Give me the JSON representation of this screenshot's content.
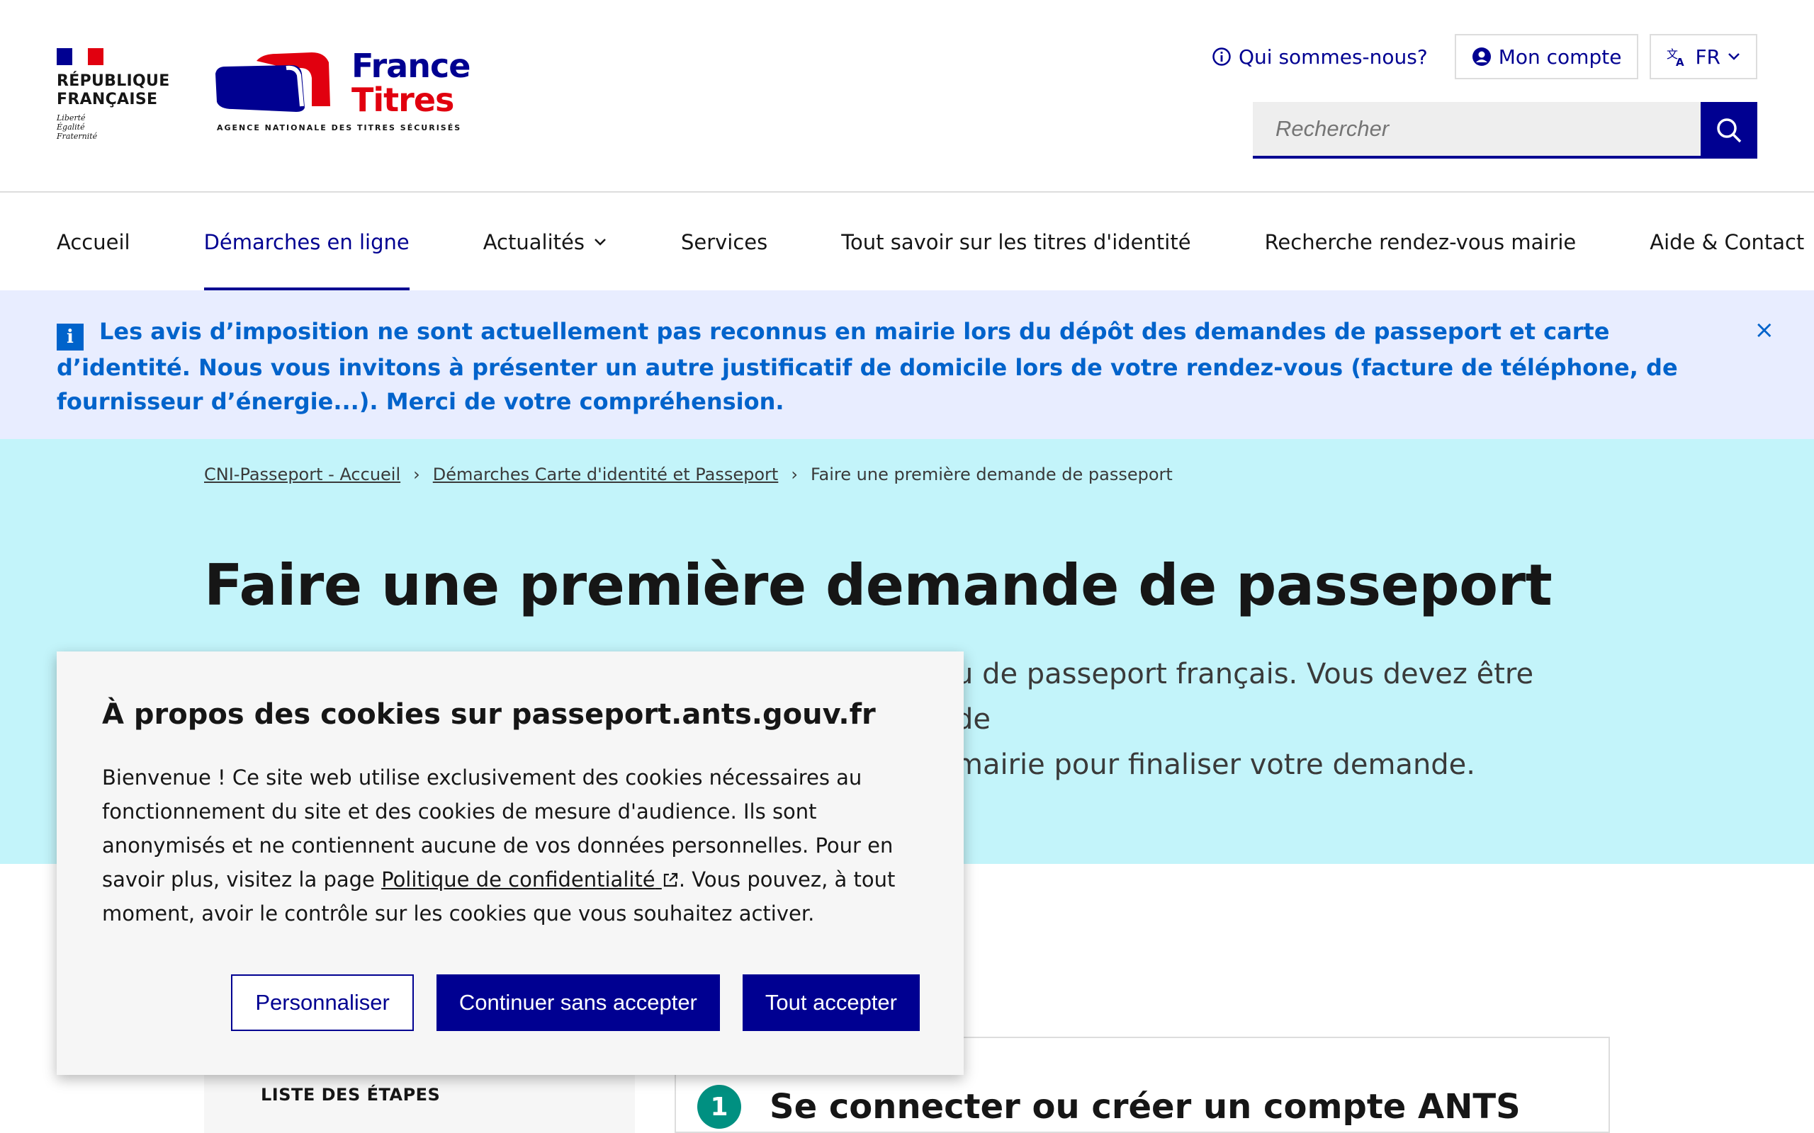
{
  "header": {
    "rf_title_line1": "RÉPUBLIQUE",
    "rf_title_line2": "FRANÇAISE",
    "rf_motto_1": "Liberté",
    "rf_motto_2": "Égalité",
    "rf_motto_3": "Fraternité",
    "logo_word1": "France",
    "logo_word2": "Titres",
    "logo_tagline": "AGENCE NATIONALE DES TITRES SÉCURISÉS",
    "about_label": "Qui sommes-nous?",
    "account_label": "Mon compte",
    "language_label": "FR",
    "search_placeholder": "Rechercher"
  },
  "nav": {
    "items": [
      {
        "label": "Accueil"
      },
      {
        "label": "Démarches en ligne"
      },
      {
        "label": "Actualités"
      },
      {
        "label": "Services"
      },
      {
        "label": "Tout savoir sur les titres d'identité"
      },
      {
        "label": "Recherche rendez-vous mairie"
      },
      {
        "label": "Aide & Contact"
      }
    ]
  },
  "notice": {
    "text": "Les avis d’imposition ne sont actuellement pas reconnus en mairie lors du dépôt des demandes de passeport et carte d’identité. Nous vous invitons à présenter un autre justificatif de domicile lors de votre rendez-vous (facture de téléphone, de fournisseur d’énergie...). Merci de votre compréhension.",
    "close_glyph": "×"
  },
  "breadcrumb": {
    "items": [
      "CNI-Passeport - Accueil",
      "Démarches Carte d'identité et Passeport"
    ],
    "current": "Faire une première demande de passeport",
    "separator": "›"
  },
  "hero": {
    "title": "Faire une première demande de passeport",
    "lede_line1": "u de passeport français. Vous devez être de",
    "lede_line2": "mairie pour finaliser votre demande."
  },
  "steps": {
    "list_title": "LISTE DES ÉTAPES",
    "first_number": "1",
    "first_title": "Se connecter ou créer un compte ANTS"
  },
  "cookie": {
    "title": "À propos des cookies sur passeport.ants.gouv.fr",
    "body_before_link": "Bienvenue ! Ce site web utilise exclusivement des cookies nécessaires au fonctionnement du site et des cookies de mesure d'audience. Ils sont anonymisés et ne contiennent aucune de vos données personnelles. Pour en savoir plus, visitez la page ",
    "link_label": "Politique de confidentialité",
    "body_after_link": ". Vous pouvez, à tout moment, avoir le contrôle sur les cookies que vous souhaitez activer.",
    "btn_customize": "Personnaliser",
    "btn_refuse": "Continuer sans accepter",
    "btn_accept": "Tout accepter"
  },
  "colors": {
    "primary_blue": "#000091",
    "republic_red": "#e1000f",
    "info_blue": "#0063cb",
    "hero_bg": "#c3f4fa",
    "notice_bg": "#e8edff",
    "step_green": "#009081"
  }
}
